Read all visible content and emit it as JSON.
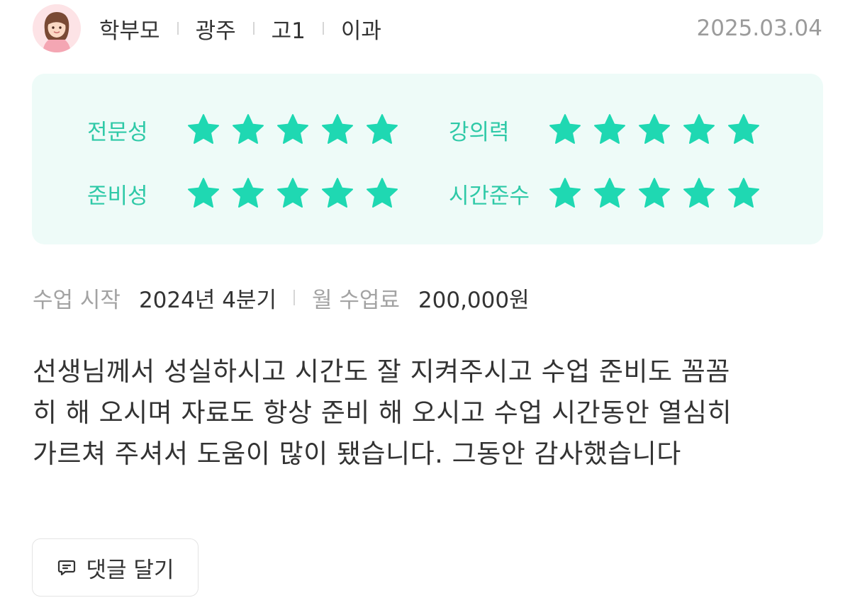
{
  "author": {
    "role": "학부모",
    "region": "광주",
    "grade": "고1",
    "track": "이과",
    "avatar_icon": "woman-avatar-icon"
  },
  "date": "2025.03.04",
  "ratings": [
    {
      "label": "전문성",
      "stars": 5,
      "max": 5
    },
    {
      "label": "강의력",
      "stars": 5,
      "max": 5
    },
    {
      "label": "준비성",
      "stars": 5,
      "max": 5
    },
    {
      "label": "시간준수",
      "stars": 5,
      "max": 5
    }
  ],
  "lesson": {
    "start_label": "수업 시작",
    "start_value": "2024년 4분기",
    "fee_label": "월 수업료",
    "fee_value": "200,000원"
  },
  "review_lines": [
    "선생님께서 성실하시고 시간도 잘 지켜주시고 수업 준비도 꼼꼼",
    "히 해 오시며 자료도 항상 준비 해 오시고 수업 시간동안 열심히",
    "가르쳐 주셔서 도움이 많이 됐습니다. 그동안 감사했습니다"
  ],
  "comment_button": {
    "label": "댓글 달기",
    "icon": "comment-icon"
  },
  "colors": {
    "accent": "#2ec9a7",
    "star": "#1fd8b2",
    "rating_bg": "#eefbf8",
    "muted": "#a3a3a3"
  }
}
